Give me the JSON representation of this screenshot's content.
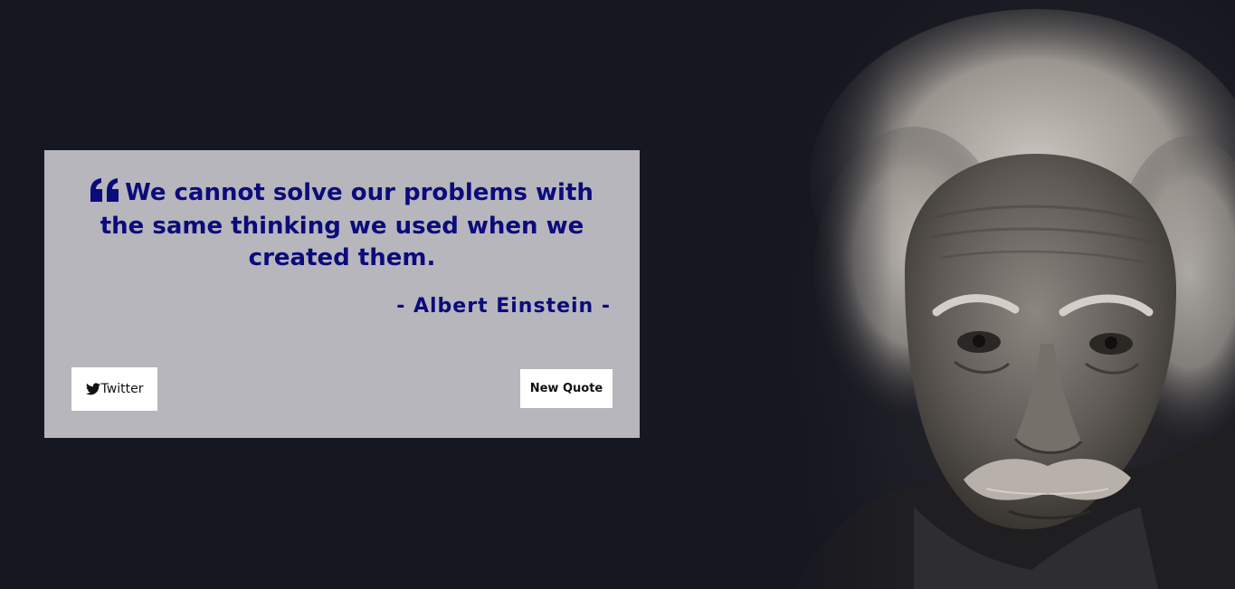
{
  "quote": {
    "text": "We cannot solve our problems with the same thinking we used when we created them.",
    "author": "- Albert Einstein -",
    "quote_icon": "quote-left-icon"
  },
  "buttons": {
    "twitter_label": "Twitter",
    "twitter_icon": "twitter-bird-icon",
    "new_quote_label": "New Quote"
  },
  "colors": {
    "background": "#161821",
    "card": "#b7b6bc",
    "text": "#0b0b7c",
    "button": "#ffffff"
  }
}
